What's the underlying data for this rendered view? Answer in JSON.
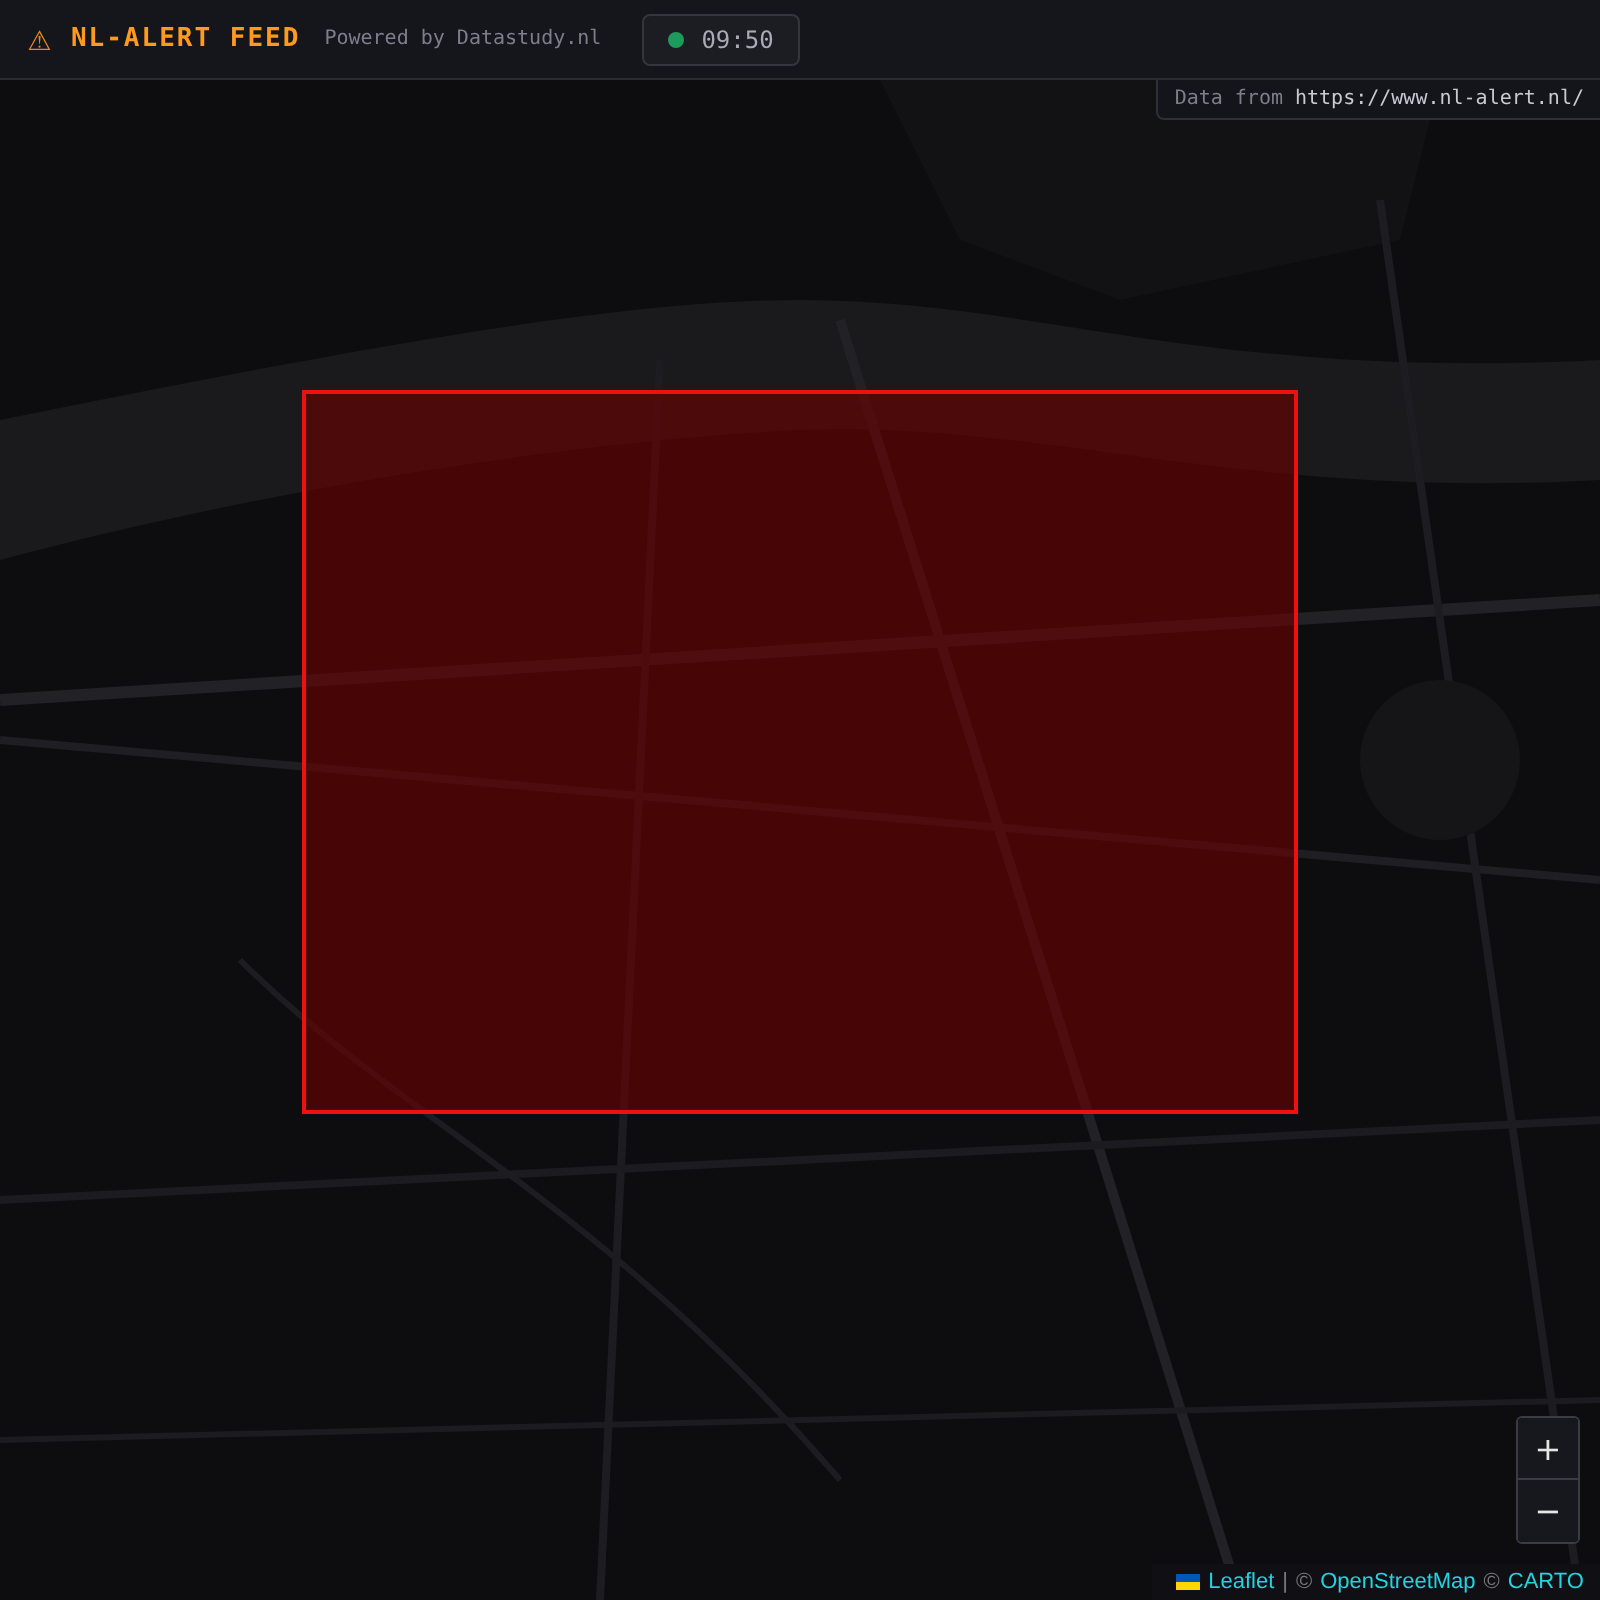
{
  "header": {
    "icon": "⚠",
    "title": "NL-ALERT FEED",
    "subtitle": "Powered by Datastudy.nl",
    "clock": {
      "time": "09:50",
      "live": true
    }
  },
  "source": {
    "label": "Data from",
    "link": "https://www.nl-alert.nl/"
  },
  "map": {
    "kind": "picture",
    "alerts": [
      {
        "kind": "rect"
      }
    ],
    "zoom_controls": [
      "+",
      "−"
    ],
    "attribution": {
      "leaflet": "Leaflet",
      "separator": "|",
      "osm_prefix": "©",
      "osm": "OpenStreetMap",
      "carto_prefix": "©",
      "carto": "CARTO"
    }
  }
}
